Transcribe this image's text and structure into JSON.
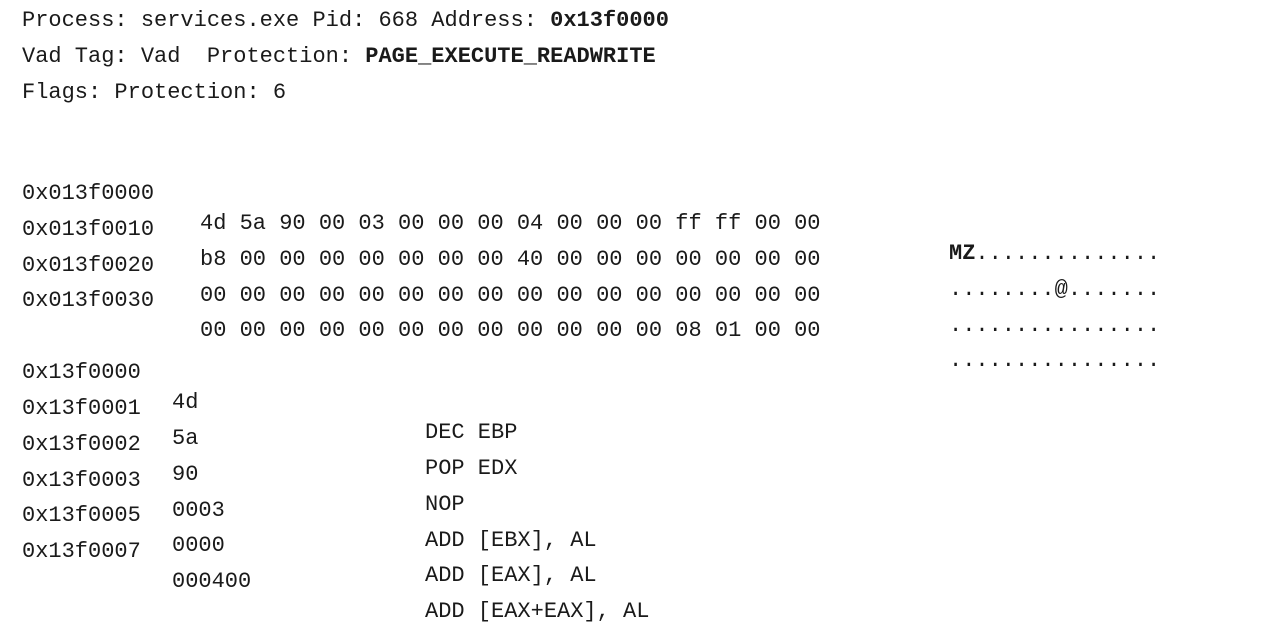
{
  "header": {
    "line1": {
      "process_label": "Process: ",
      "process_value": "services.exe",
      "pid_label": " Pid: ",
      "pid_value": "668",
      "address_label": " Address: ",
      "address_value": "0x13f0000"
    },
    "line2": {
      "vad_tag_label": "Vad Tag: ",
      "vad_tag_value": "Vad",
      "protection_label": "  Protection: ",
      "protection_value": "PAGE_EXECUTE_READWRITE"
    },
    "line3": {
      "flags_label": "Flags: ",
      "flags_value": "Protection: 6"
    }
  },
  "hexdump": [
    {
      "address": "0x013f0000",
      "bytes": "4d 5a 90 00 03 00 00 00 04 00 00 00 ff ff 00 00",
      "ascii_bold": "MZ",
      "ascii_rest": ".............."
    },
    {
      "address": "0x013f0010",
      "bytes": "b8 00 00 00 00 00 00 00 40 00 00 00 00 00 00 00",
      "ascii_bold": "",
      "ascii_rest": "........@......."
    },
    {
      "address": "0x013f0020",
      "bytes": "00 00 00 00 00 00 00 00 00 00 00 00 00 00 00 00",
      "ascii_bold": "",
      "ascii_rest": "................"
    },
    {
      "address": "0x013f0030",
      "bytes": "00 00 00 00 00 00 00 00 00 00 00 00 08 01 00 00",
      "ascii_bold": "",
      "ascii_rest": "................"
    }
  ],
  "disassembly": [
    {
      "address": "0x13f0000",
      "hex": "4d",
      "instruction": "DEC EBP"
    },
    {
      "address": "0x13f0001",
      "hex": "5a",
      "instruction": "POP EDX"
    },
    {
      "address": "0x13f0002",
      "hex": "90",
      "instruction": "NOP"
    },
    {
      "address": "0x13f0003",
      "hex": "0003",
      "instruction": "ADD [EBX], AL"
    },
    {
      "address": "0x13f0005",
      "hex": "0000",
      "instruction": "ADD [EAX], AL"
    },
    {
      "address": "0x13f0007",
      "hex": "000400",
      "instruction": "ADD [EAX+EAX], AL"
    }
  ]
}
